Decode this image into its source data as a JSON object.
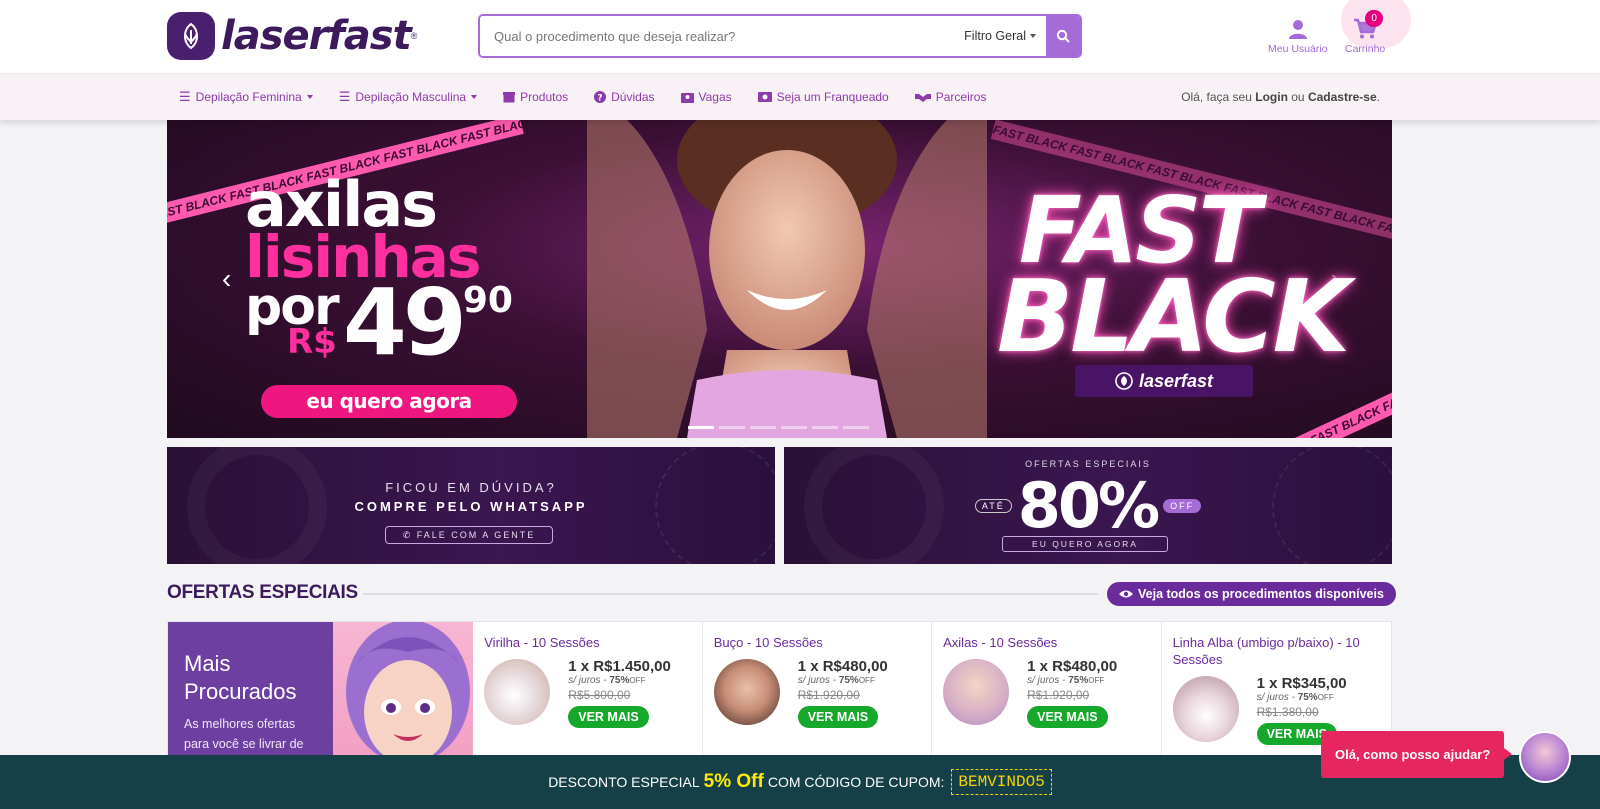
{
  "header": {
    "logo_text": "laserfast",
    "logo_reg": "®",
    "search_placeholder": "Qual o procedimento que deseja realizar?",
    "filter_label": "Filtro Geral",
    "user_label": "Meu Usuário",
    "cart_label": "Carrinho",
    "cart_count": "0"
  },
  "nav": {
    "items": [
      {
        "label": "Depilação Feminina"
      },
      {
        "label": "Depilação Masculina"
      },
      {
        "label": "Produtos"
      },
      {
        "label": "Dúvidas"
      },
      {
        "label": "Vagas"
      },
      {
        "label": "Seja um Franqueado"
      },
      {
        "label": "Parceiros"
      }
    ],
    "login_prefix": "Olá, faça seu",
    "login_link": "Login",
    "login_or": "ou",
    "register_link": "Cadastre-se",
    "login_suffix": "."
  },
  "hero": {
    "line1": "axilas",
    "line2": "lisinhas",
    "line3": "por",
    "currency": "R$",
    "price_int": "49",
    "price_cents": "90",
    "cta": "eu quero agora",
    "fast": "FAST",
    "black": "BLACK",
    "badge_logo": "laserfast",
    "ribbon_text": "FAST BLACK  FAST BLACK  FAST BLACK  FAST BLACK  FAST BLACK  FAST BLACK  FAST BLACK",
    "slides": 6,
    "active_slide": 1
  },
  "banners": {
    "whatsapp": {
      "line1": "FICOU EM DÚVIDA?",
      "line2": "COMPRE PELO WHATSAPP",
      "button": "FALE COM A GENTE"
    },
    "offers": {
      "line1": "OFERTAS ESPECIAIS",
      "ate": "ATÉ",
      "percent": "80%",
      "off": "OFF",
      "button": "EU QUERO AGORA"
    }
  },
  "section": {
    "title": "OFERTAS ESPECIAIS",
    "view_all": "Veja todos os procedimentos disponíveis"
  },
  "featured": {
    "title": "Mais Procurados",
    "text": "As melhores ofertas para você se livrar de"
  },
  "offers": [
    {
      "name": "Virilha - 10 Sessões",
      "installment": "1 x R$1.450,00",
      "juros": "s/ juros - ",
      "discount": "75%",
      "off": "OFF",
      "old_price": "R$5.800,00",
      "button": "VER MAIS"
    },
    {
      "name": "Buço - 10 Sessões",
      "installment": "1 x R$480,00",
      "juros": "s/ juros - ",
      "discount": "75%",
      "off": "OFF",
      "old_price": "R$1.920,00",
      "button": "VER MAIS"
    },
    {
      "name": "Axilas - 10 Sessões",
      "installment": "1 x R$480,00",
      "juros": "s/ juros - ",
      "discount": "75%",
      "off": "OFF",
      "old_price": "R$1.920,00",
      "button": "VER MAIS"
    },
    {
      "name": "Linha Alba (umbigo p/baixo) - 10 Sessões",
      "installment": "1 x R$345,00",
      "juros": "s/ juros - ",
      "discount": "75%",
      "off": "OFF",
      "old_price": "R$1.380,00",
      "button": "VER MAIS"
    }
  ],
  "coupon": {
    "prefix": "DESCONTO ESPECIAL",
    "percent": "5% Off",
    "middle": "COM CÓDIGO DE CUPOM:",
    "code": "BEMVINDO5"
  },
  "chat": {
    "message": "Olá, como posso ajudar?"
  },
  "colors": {
    "brand_purple": "#3d1a5c",
    "accent_purple": "#a56bd6",
    "pink": "#ef1680",
    "green": "#16a82a",
    "coupon_bg": "#164048",
    "coupon_yellow": "#ffea00"
  }
}
